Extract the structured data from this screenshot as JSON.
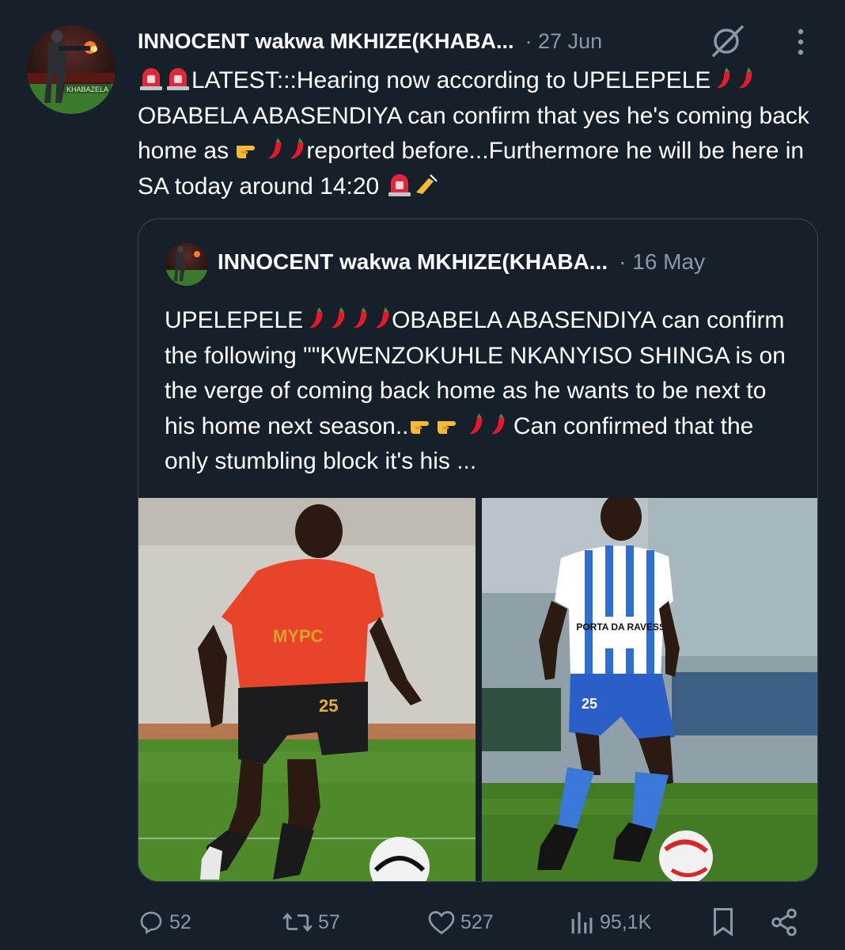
{
  "tweet": {
    "author": "INNOCENT wakwa MKHIZE(KHABA...",
    "date": "· 27 Jun",
    "avatar_text": "KHABAZELA",
    "text_parts": [
      "LATEST:::Hearing now according to UPELEPELE",
      "OBABELA ABASENDIYA can confirm that yes he's coming back home as",
      "reported before...Furthermore he will be here in SA today around 14:20"
    ]
  },
  "quote": {
    "author": "INNOCENT wakwa MKHIZE(KHABA...",
    "date": "· 16 May",
    "text_parts": [
      "UPELEPELE",
      "OBABELA ABASENDIYA can confirm the following \"\"KWENZOKUHLE NKANYISO SHINGA is on the verge of coming back home as he wants to be next to his home next season..",
      "Can confirmed that the only stumbling block it's his ..."
    ],
    "photo1_text": "MYPC",
    "photo1_number": "25",
    "photo2_sponsor": "PORTA DA RAVESSA",
    "photo2_number": "25"
  },
  "actions": {
    "replies": "52",
    "reposts": "57",
    "likes": "527",
    "views": "95,1K"
  },
  "icons": [
    "grok-icon",
    "more-icon",
    "siren-icon",
    "chili-icon",
    "pointing-hand-icon",
    "writing-hand-icon",
    "reply-icon",
    "repost-icon",
    "like-icon",
    "views-icon",
    "bookmark-icon",
    "share-icon"
  ],
  "colors": {
    "background": "#15202b",
    "muted": "#8b98a5",
    "border": "#38444d"
  }
}
